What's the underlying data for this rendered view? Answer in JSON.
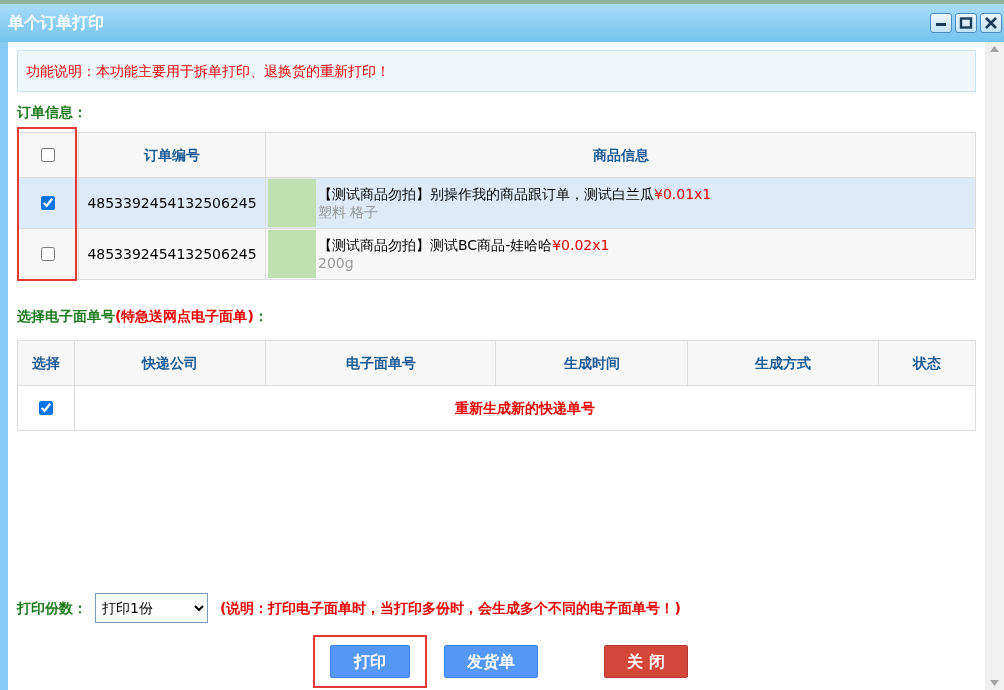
{
  "window": {
    "title": "单个订单打印"
  },
  "notice": "功能说明：本功能主要用于拆单打印、退换货的重新打印！",
  "orders_section": {
    "label": "订单信息：",
    "checkbox_column_highlighted": true,
    "header_checkbox": {
      "checked": false
    },
    "columns": [
      "订单编号",
      "商品信息"
    ],
    "rows": [
      {
        "selected": true,
        "order_no": "4853392454132506245",
        "product": {
          "name": "【测试商品勿拍】别操作我的商品跟订单，测试白兰瓜",
          "price": "¥0.01x1",
          "spec": "塑料 格子"
        }
      },
      {
        "selected": false,
        "order_no": "4853392454132506245",
        "product": {
          "name": "【测试商品勿拍】测试BC商品-娃哈哈",
          "price": "¥0.02x1",
          "spec": "200g"
        }
      }
    ]
  },
  "waybill_section": {
    "label": "选择电子面单号",
    "label_note": "(特急送网点电子面单)",
    "label_suffix": "：",
    "columns": [
      "选择",
      "快递公司",
      "电子面单号",
      "生成时间",
      "生成方式",
      "状态"
    ],
    "rows": [
      {
        "checked": true,
        "text": "重新生成新的快递单号"
      }
    ]
  },
  "copies": {
    "label": "打印份数：",
    "value": "打印1份",
    "note": "(说明：打印电子面单时，当打印多份时，会生成多个不同的电子面单号！)"
  },
  "buttons": [
    {
      "label": "打印",
      "kind": "primary",
      "highlighted": true
    },
    {
      "label": "发货单",
      "kind": "primary",
      "highlighted": false
    },
    {
      "label": "关 闭",
      "kind": "danger",
      "highlighted": false
    }
  ]
}
